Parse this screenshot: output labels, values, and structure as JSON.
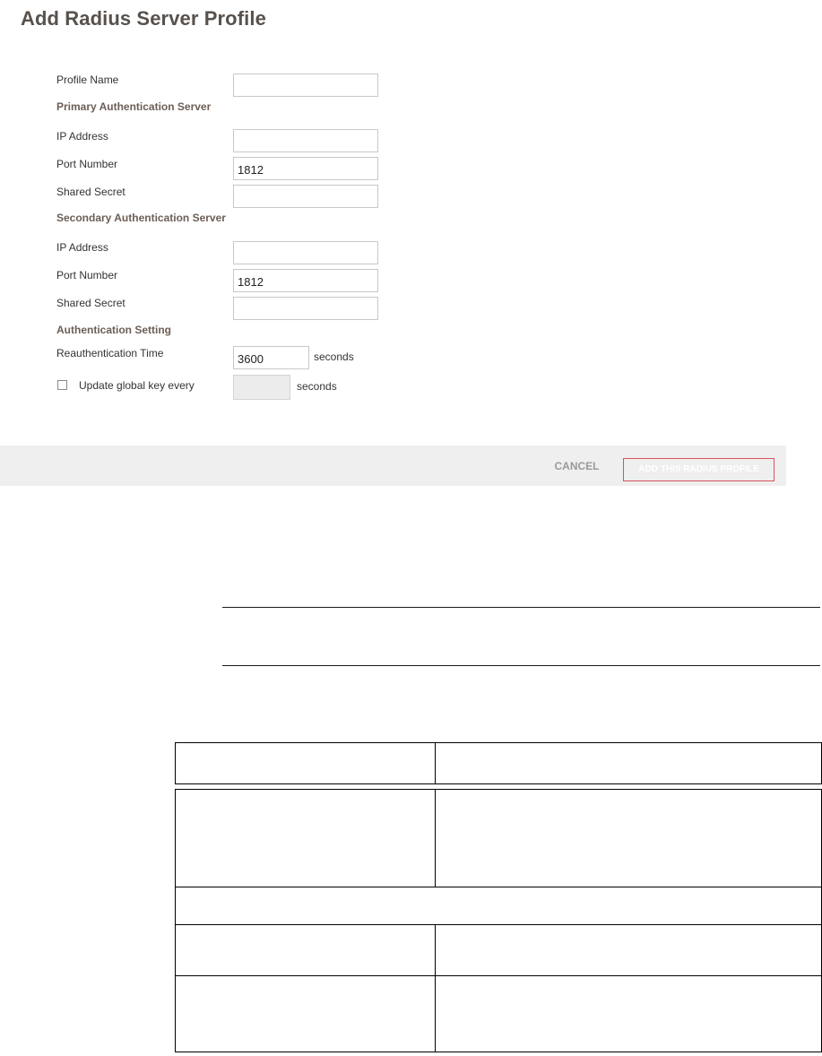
{
  "page": {
    "title": "Add Radius Server Profile"
  },
  "form": {
    "profile_name": {
      "label": "Profile Name",
      "value": ""
    },
    "primary": {
      "heading": "Primary Authentication Server",
      "ip_address": {
        "label": "IP Address",
        "value": ""
      },
      "port_number": {
        "label": "Port Number",
        "value": "1812"
      },
      "shared_secret": {
        "label": "Shared Secret",
        "value": ""
      }
    },
    "secondary": {
      "heading": "Secondary Authentication Server",
      "ip_address": {
        "label": "IP Address",
        "value": ""
      },
      "port_number": {
        "label": "Port Number",
        "value": "1812"
      },
      "shared_secret": {
        "label": "Shared Secret",
        "value": ""
      }
    },
    "auth_setting": {
      "heading": "Authentication Setting",
      "reauth_time": {
        "label": "Reauthentication Time",
        "value": "3600",
        "unit": "seconds"
      },
      "update_global_key": {
        "label": "Update global key every",
        "checked": false,
        "value": "",
        "unit": "seconds"
      }
    }
  },
  "footer": {
    "cancel_label": "CANCEL",
    "submit_label": "ADD THIS RADIUS PROFILE"
  },
  "colors": {
    "title": "#58514c",
    "section_heading": "#6b5e55",
    "footer_bg": "#efefef",
    "accent_red": "#d8525a"
  }
}
